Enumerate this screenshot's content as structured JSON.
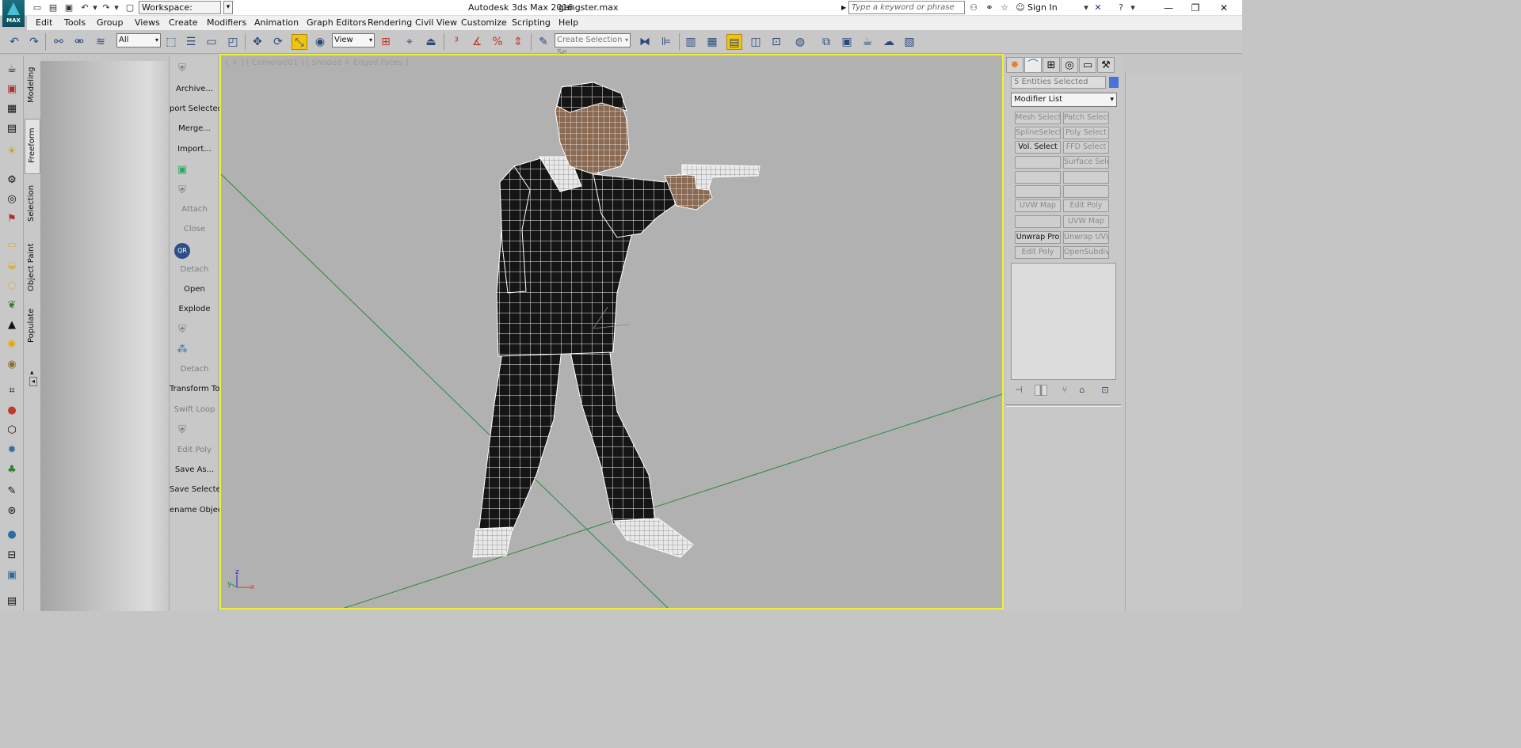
{
  "window": {
    "app_title": "Autodesk 3ds Max 2016",
    "file_name": "gangster.max",
    "logo_label": "MAX",
    "workspace_label": "Workspace: Default",
    "search_placeholder": "Type a keyword or phrase",
    "sign_in": "Sign In"
  },
  "menu": {
    "items": [
      "Edit",
      "Tools",
      "Group",
      "Views",
      "Create",
      "Modifiers",
      "Animation",
      "Graph Editors",
      "Rendering",
      "Civil View",
      "Customize",
      "Scripting",
      "Help"
    ]
  },
  "toolbar": {
    "selection_filter": "All",
    "ref_coord": "View",
    "named_selection_placeholder": "Create Selection Se"
  },
  "ribbon": {
    "tabs": [
      "Modeling",
      "Freeform",
      "Selection",
      "Object Paint",
      "Populate"
    ],
    "active_tab": "Freeform"
  },
  "graphite_panel": {
    "archive": "Archive...",
    "export_selected": "port Selected",
    "merge": "Merge...",
    "import": "Import...",
    "attach": "Attach",
    "close": "Close",
    "detach1": "Detach",
    "open": "Open",
    "explode": "Explode",
    "detach2": "Detach",
    "transform_tool": "Transform Tool",
    "swift_loop": "Swift Loop",
    "edit_poly": "Edit Poly",
    "save_as": "Save As...",
    "save_selected": "Save Selected",
    "rename_objects": "ename Objects",
    "qr_label": "QR"
  },
  "viewport": {
    "label": "[ + ] [ Camera001 ] [ Shaded + Edged Faces ]",
    "axis_x": "x",
    "axis_y": "y",
    "axis_z": "z"
  },
  "command_panel": {
    "selection_status": "5 Entities Selected",
    "selection_color": "#4a72d8",
    "modifier_list": "Modifier List",
    "modifier_buttons": [
      [
        "Mesh Select",
        "Patch Select"
      ],
      [
        "SplineSelect",
        "Poly Select"
      ],
      [
        "Vol. Select",
        "FFD Select"
      ],
      [
        "",
        "Surface Select"
      ],
      [
        "",
        ""
      ],
      [
        "",
        ""
      ],
      [
        "UVW Map",
        "Edit Poly"
      ],
      [
        "",
        "UVW Map"
      ],
      [
        "Unwrap Pro",
        "Unwrap UVW"
      ],
      [
        "Edit Poly",
        "OpenSubdiv"
      ]
    ],
    "active_buttons": [
      "Vol. Select",
      "Unwrap Pro"
    ]
  },
  "colors": {
    "viewport_border": "#f0f03a",
    "viewport_bg": "#b1b1b1",
    "panel_bg": "#c8c8c8",
    "grid_line": "#2b8a3e"
  }
}
